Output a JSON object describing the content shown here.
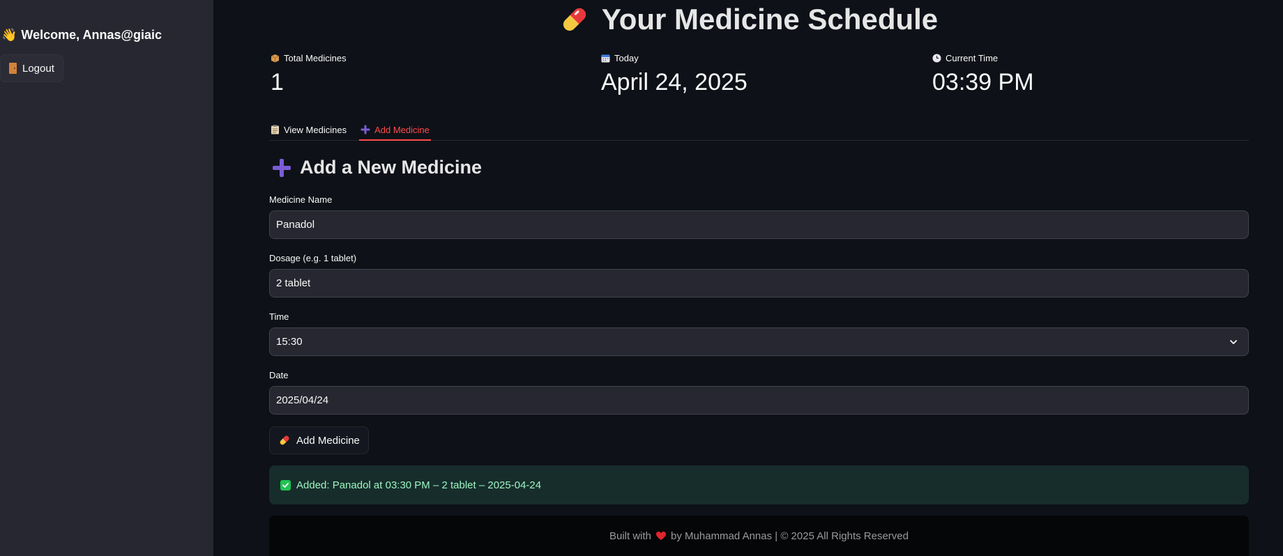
{
  "sidebar": {
    "welcome_text": "Welcome, Annas@giaic",
    "wave_emoji": "👋",
    "logout_label": "Logout"
  },
  "header": {
    "title": "Your Medicine Schedule"
  },
  "metrics": {
    "total": {
      "label": "Total Medicines",
      "value": "1"
    },
    "today": {
      "label": "Today",
      "value": "April 24, 2025"
    },
    "time": {
      "label": "Current Time",
      "value": "03:39 PM"
    }
  },
  "tabs": [
    {
      "label": "View Medicines",
      "active": false
    },
    {
      "label": "Add Medicine",
      "active": true
    }
  ],
  "form": {
    "heading": "Add a New Medicine",
    "name_label": "Medicine Name",
    "name_value": "Panadol",
    "dosage_label": "Dosage (e.g. 1 tablet)",
    "dosage_value": "2 tablet",
    "time_label": "Time",
    "time_value": "15:30",
    "date_label": "Date",
    "date_value": "2025/04/24",
    "submit_label": "Add Medicine"
  },
  "alert": {
    "text": "Added: Panadol at 03:30 PM – 2 tablet – 2025-04-24"
  },
  "footer": {
    "before": "Built with",
    "after": "by Muhammad Annas | © 2025 All Rights Reserved"
  },
  "colors": {
    "background": "#0e1117",
    "sidebar": "#262730",
    "accent_red": "#ff4b4b",
    "success_bg": "#172d2b",
    "success_text": "#9df5c3",
    "plus_purple": "#7b5cd6"
  }
}
